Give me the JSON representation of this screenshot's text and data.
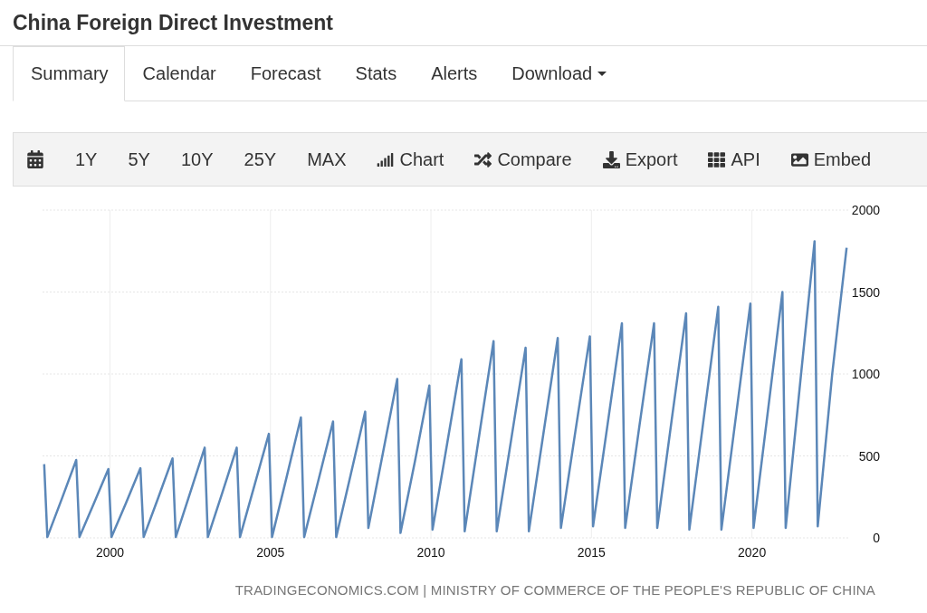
{
  "title": "China Foreign Direct Investment",
  "tabs": [
    {
      "label": "Summary",
      "selected": true,
      "dropdown": false
    },
    {
      "label": "Calendar",
      "selected": false,
      "dropdown": false
    },
    {
      "label": "Forecast",
      "selected": false,
      "dropdown": false
    },
    {
      "label": "Stats",
      "selected": false,
      "dropdown": false
    },
    {
      "label": "Alerts",
      "selected": false,
      "dropdown": false
    },
    {
      "label": "Download",
      "selected": false,
      "dropdown": true
    }
  ],
  "toolbar": {
    "ranges": [
      "1Y",
      "5Y",
      "10Y",
      "25Y",
      "MAX"
    ],
    "actions": [
      "Chart",
      "Compare",
      "Export",
      "API",
      "Embed"
    ]
  },
  "chart_data": {
    "type": "line",
    "xlim": [
      1997.9,
      2023
    ],
    "ylim": [
      0,
      2000
    ],
    "xticks": [
      2000,
      2005,
      2010,
      2015,
      2020
    ],
    "yticks": [
      0,
      500,
      1000,
      1500,
      2000
    ],
    "x": [
      1997.95,
      1998.05,
      1998.5,
      1998.95,
      1999.05,
      1999.5,
      1999.95,
      2000.05,
      2000.5,
      2000.95,
      2001.05,
      2001.5,
      2001.95,
      2002.05,
      2002.5,
      2002.95,
      2003.05,
      2003.5,
      2003.95,
      2004.05,
      2004.5,
      2004.95,
      2005.05,
      2005.5,
      2005.95,
      2006.05,
      2006.5,
      2006.95,
      2007.05,
      2007.5,
      2007.95,
      2008.05,
      2008.5,
      2008.95,
      2009.05,
      2009.5,
      2009.95,
      2010.05,
      2010.5,
      2010.95,
      2011.05,
      2011.5,
      2011.95,
      2012.05,
      2012.5,
      2012.95,
      2013.05,
      2013.5,
      2013.95,
      2014.05,
      2014.5,
      2014.95,
      2015.05,
      2015.5,
      2015.95,
      2016.05,
      2016.5,
      2016.95,
      2017.05,
      2017.5,
      2017.95,
      2018.05,
      2018.5,
      2018.95,
      2019.05,
      2019.5,
      2019.95,
      2020.05,
      2020.5,
      2020.95,
      2021.05,
      2021.5,
      2021.95,
      2022.05,
      2022.5,
      2022.95
    ],
    "grid": true,
    "series": [
      {
        "color": "#5b87b8",
        "values": [
          450,
          5,
          238,
          475,
          5,
          210,
          420,
          5,
          212,
          425,
          5,
          242,
          485,
          5,
          275,
          550,
          5,
          275,
          550,
          5,
          318,
          635,
          5,
          368,
          735,
          5,
          355,
          710,
          5,
          385,
          770,
          60,
          515,
          970,
          30,
          465,
          930,
          50,
          570,
          1090,
          40,
          620,
          1200,
          40,
          600,
          1160,
          40,
          630,
          1220,
          60,
          650,
          1230,
          70,
          690,
          1310,
          60,
          690,
          1310,
          60,
          720,
          1370,
          50,
          730,
          1410,
          50,
          740,
          1430,
          60,
          780,
          1500,
          60,
          940,
          1810,
          70,
          1000,
          1770
        ]
      }
    ]
  },
  "source": "TRADINGECONOMICS.COM | MINISTRY OF COMMERCE OF THE PEOPLE'S REPUBLIC OF CHINA"
}
